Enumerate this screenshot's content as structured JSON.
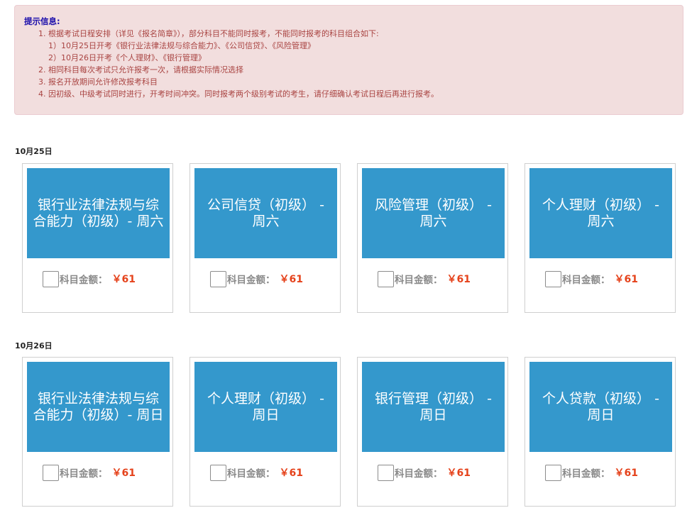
{
  "notice": {
    "title": "提示信息:",
    "lines": [
      "1. 根据考试日程安排（详见《报名简章》），部分科目不能同时报考，不能同时报考的科目组合如下:",
      "1）10月25日开考《银行业法律法规与综合能力》、《公司信贷》、《风险管理》",
      "2）10月26日开考《个人理财》、《银行管理》",
      "2. 相同科目每次考试只允许报考一次，请根据实际情况选择",
      "3. 报名开放期间允许修改报考科目",
      "4. 因初级、中级考试同时进行，开考时间冲突。同时报考两个级别考试的考生，请仔细确认考试日程后再进行报考。"
    ]
  },
  "price_label": "科目金额：",
  "groups": [
    {
      "date": "10月25日",
      "cards": [
        {
          "title": "银行业法律法规与综合能力（初级）- 周六",
          "price": "￥61"
        },
        {
          "title": "公司信贷（初级） - 周六",
          "price": "￥61"
        },
        {
          "title": "风险管理（初级） - 周六",
          "price": "￥61"
        },
        {
          "title": "个人理财（初级） - 周六",
          "price": "￥61"
        }
      ]
    },
    {
      "date": "10月26日",
      "cards": [
        {
          "title": "银行业法律法规与综合能力（初级）- 周日",
          "price": "￥61"
        },
        {
          "title": "个人理财（初级） - 周日",
          "price": "￥61"
        },
        {
          "title": "银行管理（初级） - 周日",
          "price": "￥61"
        },
        {
          "title": "个人贷款（初级） - 周日",
          "price": "￥61"
        }
      ]
    }
  ]
}
